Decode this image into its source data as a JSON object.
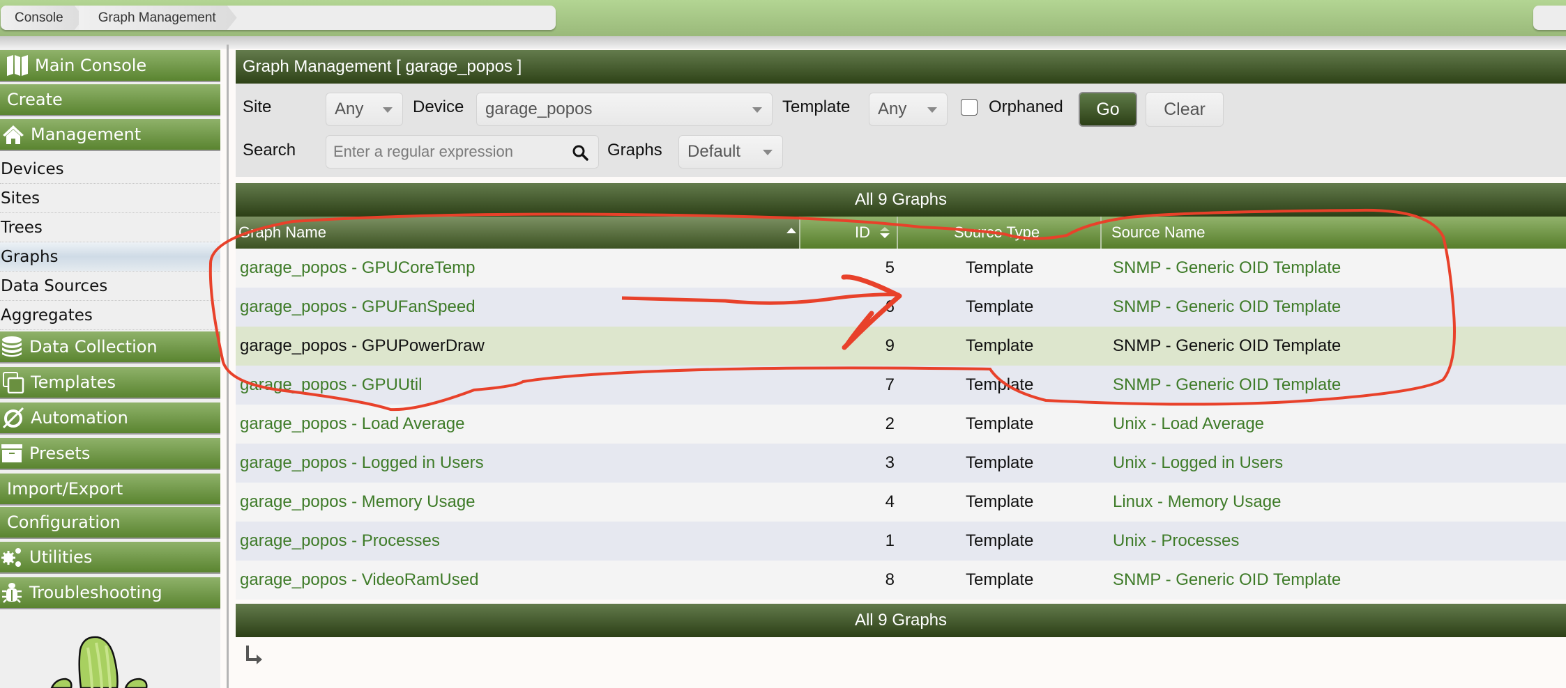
{
  "breadcrumb": [
    {
      "label": "Console"
    },
    {
      "label": "Graph Management"
    }
  ],
  "sidebar": {
    "sections": [
      {
        "label": "Main Console",
        "icon": "map-icon"
      },
      {
        "label": "Create",
        "icon": ""
      },
      {
        "label": "Management",
        "icon": "home-icon"
      },
      {
        "label": "Data Collection",
        "icon": "database-icon"
      },
      {
        "label": "Templates",
        "icon": "copy-icon"
      },
      {
        "label": "Automation",
        "icon": "automation-icon"
      },
      {
        "label": "Presets",
        "icon": "archive-icon"
      },
      {
        "label": "Import/Export",
        "icon": ""
      },
      {
        "label": "Configuration",
        "icon": ""
      },
      {
        "label": "Utilities",
        "icon": "gears-icon"
      },
      {
        "label": "Troubleshooting",
        "icon": "bug-icon"
      }
    ],
    "management_items": [
      {
        "label": "Devices"
      },
      {
        "label": "Sites"
      },
      {
        "label": "Trees"
      },
      {
        "label": "Graphs",
        "active": true
      },
      {
        "label": "Data Sources"
      },
      {
        "label": "Aggregates"
      }
    ]
  },
  "panel": {
    "title": "Graph Management [ garage_popos ]"
  },
  "filters": {
    "site_label": "Site",
    "site_value": "Any",
    "device_label": "Device",
    "device_value": "garage_popos",
    "template_label": "Template",
    "template_value": "Any",
    "orphaned_label": "Orphaned",
    "orphaned_checked": false,
    "go_label": "Go",
    "clear_label": "Clear",
    "search_label": "Search",
    "search_placeholder": "Enter a regular expression",
    "search_value": "",
    "graphs_label": "Graphs",
    "graphs_value": "Default"
  },
  "table": {
    "nav_top": "All 9 Graphs",
    "nav_bottom": "All 9 Graphs",
    "columns": [
      {
        "label": "Graph Name",
        "sort": "ascending"
      },
      {
        "label": "ID",
        "sort": "sortable"
      },
      {
        "label": "Source Type"
      },
      {
        "label": "Source Name"
      }
    ],
    "rows": [
      {
        "name": "garage_popos - GPUCoreTemp",
        "id": "5",
        "source_type": "Template",
        "source_name": "SNMP - Generic OID Template"
      },
      {
        "name": "garage_popos - GPUFanSpeed",
        "id": "6",
        "source_type": "Template",
        "source_name": "SNMP - Generic OID Template"
      },
      {
        "name": "garage_popos - GPUPowerDraw",
        "id": "9",
        "source_type": "Template",
        "source_name": "SNMP - Generic OID Template",
        "selected": true
      },
      {
        "name": "garage_popos - GPUUtil",
        "id": "7",
        "source_type": "Template",
        "source_name": "SNMP - Generic OID Template"
      },
      {
        "name": "garage_popos - Load Average",
        "id": "2",
        "source_type": "Template",
        "source_name": "Unix - Load Average"
      },
      {
        "name": "garage_popos - Logged in Users",
        "id": "3",
        "source_type": "Template",
        "source_name": "Unix - Logged in Users"
      },
      {
        "name": "garage_popos - Memory Usage",
        "id": "4",
        "source_type": "Template",
        "source_name": "Linux - Memory Usage"
      },
      {
        "name": "garage_popos - Processes",
        "id": "1",
        "source_type": "Template",
        "source_name": "Unix - Processes"
      },
      {
        "name": "garage_popos - VideoRamUsed",
        "id": "8",
        "source_type": "Template",
        "source_name": "SNMP - Generic OID Template"
      }
    ]
  },
  "colors": {
    "header_dark": "#2e4217",
    "header_light": "#637b4c",
    "menu_green": "#5a8430",
    "link_green": "#3e7b28",
    "annotation_red": "#e8412a",
    "selected_row": "#dde6cd"
  }
}
